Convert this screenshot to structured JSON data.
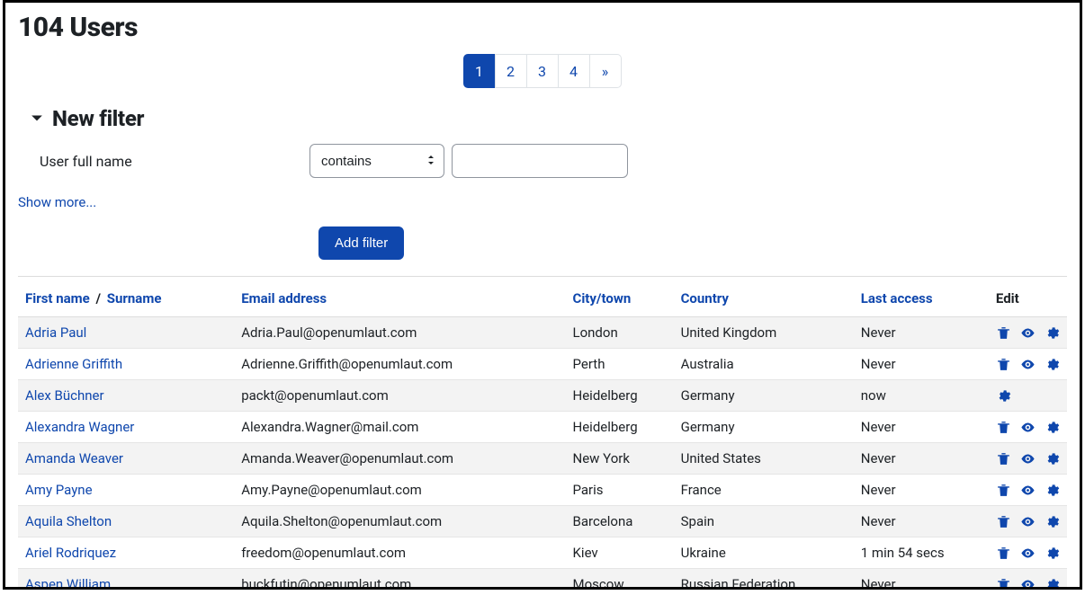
{
  "title": "104 Users",
  "pagination": {
    "pages": [
      "1",
      "2",
      "3",
      "4"
    ],
    "next_glyph": "»",
    "active_index": 0
  },
  "filter": {
    "heading": "New filter",
    "field_label": "User full name",
    "operator_options": [
      "contains"
    ],
    "operator_selected": "contains",
    "value": "",
    "show_more": "Show more...",
    "add_button": "Add filter"
  },
  "table": {
    "headers": {
      "first_name": "First name",
      "surname": "Surname",
      "email": "Email address",
      "city": "City/town",
      "country": "Country",
      "last_access": "Last access",
      "edit": "Edit"
    },
    "rows": [
      {
        "name": "Adria Paul",
        "email": "Adria.Paul@openumlaut.com",
        "city": "London",
        "country": "United Kingdom",
        "last_access": "Never",
        "actions": [
          "delete",
          "eye",
          "gear"
        ]
      },
      {
        "name": "Adrienne Griffith",
        "email": "Adrienne.Griffith@openumlaut.com",
        "city": "Perth",
        "country": "Australia",
        "last_access": "Never",
        "actions": [
          "delete",
          "eye",
          "gear"
        ]
      },
      {
        "name": "Alex Büchner",
        "email": "packt@openumlaut.com",
        "city": "Heidelberg",
        "country": "Germany",
        "last_access": "now",
        "actions": [
          "gear"
        ]
      },
      {
        "name": "Alexandra Wagner",
        "email": "Alexandra.Wagner@mail.com",
        "city": "Heidelberg",
        "country": "Germany",
        "last_access": "Never",
        "actions": [
          "delete",
          "eye",
          "gear"
        ]
      },
      {
        "name": "Amanda Weaver",
        "email": "Amanda.Weaver@openumlaut.com",
        "city": "New York",
        "country": "United States",
        "last_access": "Never",
        "actions": [
          "delete",
          "eye",
          "gear"
        ]
      },
      {
        "name": "Amy Payne",
        "email": "Amy.Payne@openumlaut.com",
        "city": "Paris",
        "country": "France",
        "last_access": "Never",
        "actions": [
          "delete",
          "eye",
          "gear"
        ]
      },
      {
        "name": "Aquila Shelton",
        "email": "Aquila.Shelton@openumlaut.com",
        "city": "Barcelona",
        "country": "Spain",
        "last_access": "Never",
        "actions": [
          "delete",
          "eye",
          "gear"
        ]
      },
      {
        "name": "Ariel Rodriquez",
        "email": "freedom@openumlaut.com",
        "city": "Kiev",
        "country": "Ukraine",
        "last_access": "1 min 54 secs",
        "actions": [
          "delete",
          "eye",
          "gear"
        ]
      },
      {
        "name": "Aspen William",
        "email": "buckfutin@openumlaut.com",
        "city": "Moscow",
        "country": "Russian Federation",
        "last_access": "Never",
        "actions": [
          "delete",
          "eye",
          "gear"
        ]
      }
    ]
  },
  "colors": {
    "link": "#0f47ad",
    "primary": "#0f47ad"
  }
}
